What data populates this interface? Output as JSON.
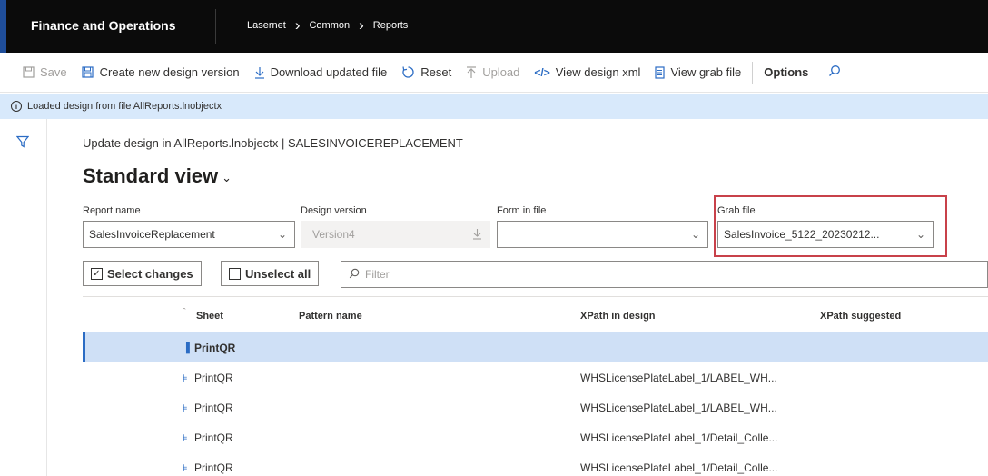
{
  "topbar": {
    "app_title": "Finance and Operations",
    "breadcrumb": [
      "Lasernet",
      "Common",
      "Reports"
    ]
  },
  "actions": {
    "save": "Save",
    "create_version": "Create new design version",
    "download": "Download updated file",
    "reset": "Reset",
    "upload": "Upload",
    "view_xml": "View design xml",
    "view_grab": "View grab file",
    "options": "Options"
  },
  "message": "Loaded design from file AllReports.lnobjectx",
  "caption": "Update design in AllReports.lnobjectx  |  SALESINVOICEREPLACEMENT",
  "view_title": "Standard view",
  "fields": {
    "report_name_label": "Report name",
    "report_name_value": "SalesInvoiceReplacement",
    "design_version_label": "Design version",
    "design_version_value": "Version4",
    "form_in_file_label": "Form in file",
    "form_in_file_value": "",
    "grab_file_label": "Grab file",
    "grab_file_value": "SalesInvoice_5122_20230212..."
  },
  "buttons": {
    "select_changes": "Select changes",
    "unselect_all": "Unselect all",
    "filter_placeholder": "Filter"
  },
  "grid": {
    "columns": [
      "Sheet",
      "Pattern name",
      "XPath in design",
      "XPath suggested"
    ],
    "rows": [
      {
        "sheet": "PrintQR",
        "pattern": "",
        "xpath_design": "",
        "xpath_suggested": ""
      },
      {
        "sheet": "PrintQR",
        "pattern": "",
        "xpath_design": "WHSLicensePlateLabel_1/LABEL_WH...",
        "xpath_suggested": ""
      },
      {
        "sheet": "PrintQR",
        "pattern": "",
        "xpath_design": "WHSLicensePlateLabel_1/LABEL_WH...",
        "xpath_suggested": ""
      },
      {
        "sheet": "PrintQR",
        "pattern": "",
        "xpath_design": "WHSLicensePlateLabel_1/Detail_Colle...",
        "xpath_suggested": ""
      },
      {
        "sheet": "PrintQR",
        "pattern": "",
        "xpath_design": "WHSLicensePlateLabel_1/Detail_Colle...",
        "xpath_suggested": ""
      }
    ]
  },
  "colors": {
    "accent": "#2b6cc4",
    "topbar": "#0b0b0b",
    "message_bg": "#d8e9fb",
    "selected_row": "#cfe0f6",
    "highlight_border": "#c8414a"
  }
}
